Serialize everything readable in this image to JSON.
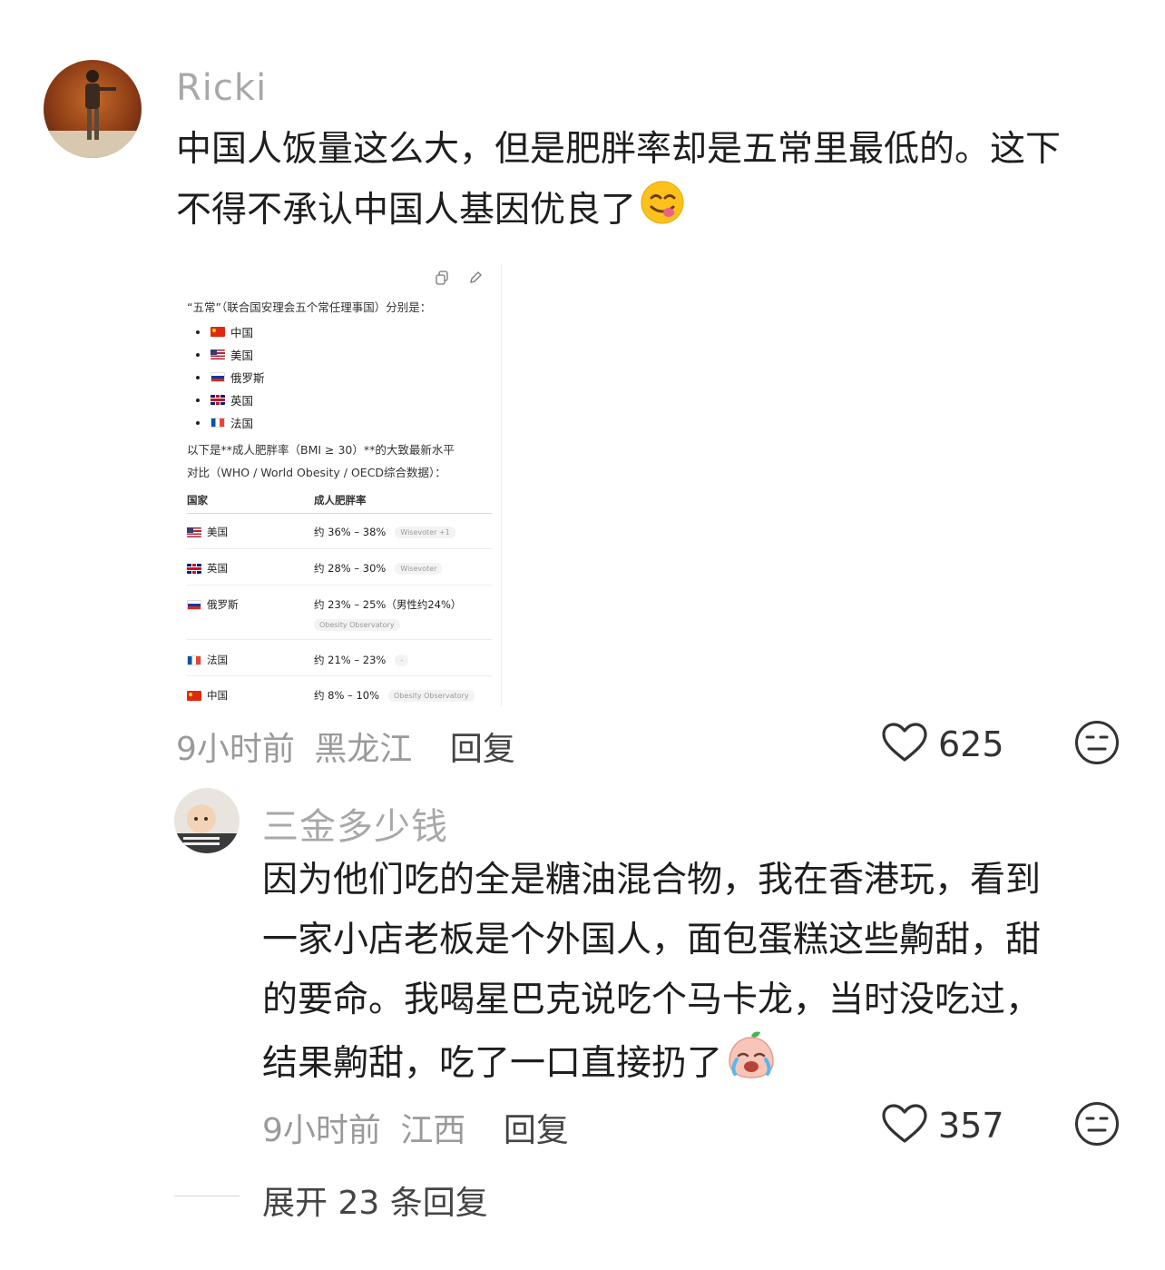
{
  "comment1": {
    "author": "Ricki",
    "text_line1": "中国人饭量这么大，但是肥胖率却是五常里最低的。这下",
    "text_line2": "不得不承认中国人基因优良了",
    "emoji": "yum-face-emoji",
    "time": "9小时前",
    "location": "黑龙江",
    "reply_label": "回复",
    "likes": "625"
  },
  "screenshot": {
    "intro": "“五常”（联合国安理会五个常任理事国）分别是：",
    "members": [
      {
        "flag": "cn",
        "name": "中国"
      },
      {
        "flag": "us",
        "name": "美国"
      },
      {
        "flag": "ru",
        "name": "俄罗斯"
      },
      {
        "flag": "uk",
        "name": "英国"
      },
      {
        "flag": "fr",
        "name": "法国"
      }
    ],
    "para_line1": "以下是**成人肥胖率（BMI ≥ 30）**的大致最新水平",
    "para_line2": "对比（WHO / World Obesity / OECD综合数据）：",
    "col_country": "国家",
    "col_rate": "成人肥胖率",
    "rows": [
      {
        "flag": "us",
        "country": "美国",
        "rate": "约 36% – 38%",
        "source": "Wisevoter +1"
      },
      {
        "flag": "uk",
        "country": "英国",
        "rate": "约 28% – 30%",
        "source": "Wisevoter"
      },
      {
        "flag": "ru",
        "country": "俄罗斯",
        "rate": "约 23% – 25%（男性约24%）",
        "source": "Obesity Observatory"
      },
      {
        "flag": "fr",
        "country": "法国",
        "rate": "约 21% – 23%",
        "source": "-"
      },
      {
        "flag": "cn",
        "country": "中国",
        "rate": "约 8% – 10%",
        "source": "Obesity Observatory"
      }
    ]
  },
  "comment2": {
    "author": "三金多少钱",
    "text_line1": "因为他们吃的全是糖油混合物，我在香港玩，看到",
    "text_line2": "一家小店老板是个外国人，面包蛋糕这些齁甜，甜",
    "text_line3": "的要命。我喝星巴克说吃个马卡龙，当时没吃过，",
    "text_line4": "结果齁甜，吃了一口直接扔了",
    "emoji": "crying-peach-emoji",
    "time": "9小时前",
    "location": "江西",
    "reply_label": "回复",
    "likes": "357"
  },
  "expand_replies": "展开 23 条回复",
  "colors": {
    "name": "#a8a8a8",
    "text": "#1e1e1e",
    "meta": "#9a9a9a"
  }
}
